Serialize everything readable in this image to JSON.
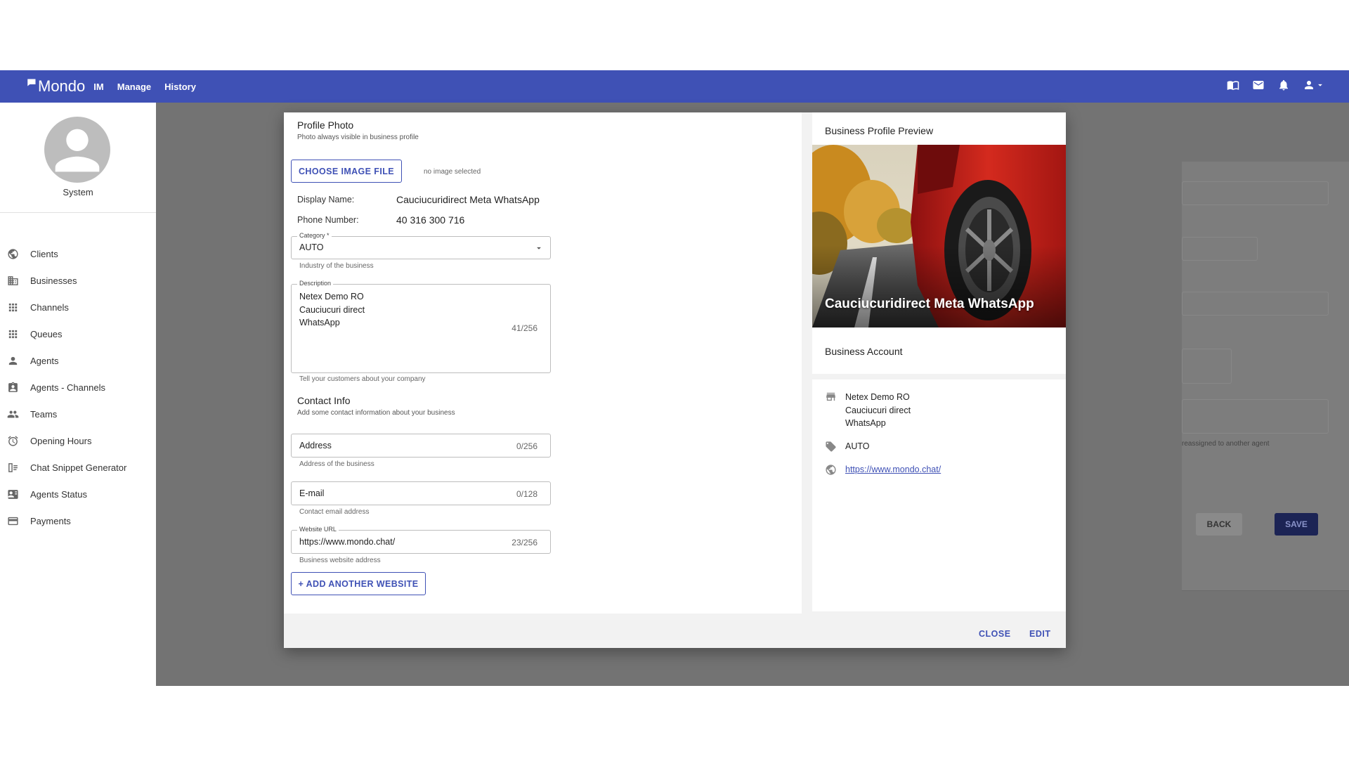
{
  "app": {
    "brand": "Mondo",
    "nav": [
      "IM",
      "Manage",
      "History"
    ],
    "top_icons": [
      "book-icon",
      "mail-icon",
      "bell-icon",
      "account-icon",
      "caret-down-icon"
    ]
  },
  "sidebar": {
    "user_name": "System",
    "items": [
      {
        "label": "Clients",
        "icon": "globe-icon"
      },
      {
        "label": "Businesses",
        "icon": "building-icon"
      },
      {
        "label": "Channels",
        "icon": "grid-icon"
      },
      {
        "label": "Queues",
        "icon": "grid-icon"
      },
      {
        "label": "Agents",
        "icon": "person-icon"
      },
      {
        "label": "Agents - Channels",
        "icon": "badge-icon"
      },
      {
        "label": "Teams",
        "icon": "people-icon"
      },
      {
        "label": "Opening Hours",
        "icon": "alarm-icon"
      },
      {
        "label": "Chat Snippet Generator",
        "icon": "snippet-icon"
      },
      {
        "label": "Agents Status",
        "icon": "id-card-icon"
      },
      {
        "label": "Payments",
        "icon": "credit-card-icon"
      }
    ]
  },
  "background": {
    "helper_text": "reassigned to another agent",
    "back_label": "BACK",
    "save_label": "SAVE"
  },
  "modal": {
    "profile_photo": {
      "title": "Profile Photo",
      "subtitle": "Photo always visible in business profile",
      "choose_label": "CHOOSE IMAGE FILE",
      "no_image": "no image selected"
    },
    "display_name": {
      "label": "Display Name:",
      "value": "Cauciucuridirect Meta WhatsApp"
    },
    "phone_number": {
      "label": "Phone Number:",
      "value": "40 316 300 716"
    },
    "category": {
      "legend": "Category *",
      "value": "AUTO",
      "helper": "Industry of the business"
    },
    "description": {
      "legend": "Description",
      "lines": [
        "Netex Demo RO",
        "Cauciucuri direct",
        "WhatsApp"
      ],
      "counter": "41/256",
      "helper": "Tell your customers about your company"
    },
    "contact_info": {
      "title": "Contact Info",
      "subtitle": "Add some contact information about your business"
    },
    "address": {
      "placeholder": "Address",
      "counter": "0/256",
      "helper": "Address of the business"
    },
    "email": {
      "placeholder": "E-mail",
      "counter": "0/128",
      "helper": "Contact email address"
    },
    "website": {
      "legend": "Website URL",
      "value": "https://www.mondo.chat/",
      "counter": "23/256",
      "helper": "Business website address"
    },
    "add_website_label": "+ ADD ANOTHER WEBSITE",
    "preview": {
      "title": "Business Profile Preview",
      "hero_name": "Cauciucuridirect Meta WhatsApp",
      "account_title": "Business Account",
      "description_lines": [
        "Netex Demo RO",
        "Cauciucuri direct",
        "WhatsApp"
      ],
      "category": "AUTO",
      "website": "https://www.mondo.chat/"
    },
    "close_label": "CLOSE",
    "edit_label": "EDIT"
  }
}
